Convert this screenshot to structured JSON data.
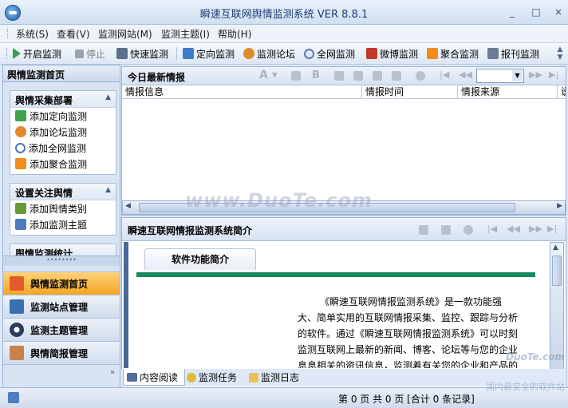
{
  "app": {
    "title": "瞬速互联网舆情监测系统 VER 8.8.1"
  },
  "window": {
    "minimize": "_",
    "restore": "□",
    "close": "×"
  },
  "menu": [
    "系统(S)",
    "查看(V)",
    "监测网站(M)",
    "监测主题(I)",
    "帮助(H)"
  ],
  "toolbar": [
    {
      "label": "开启监测",
      "icon": "play-icon",
      "color": "#3aa04a"
    },
    {
      "label": "停止",
      "icon": "stop-icon",
      "color": "#9aa3ad"
    },
    {
      "label": "快速监测",
      "icon": "printer-icon",
      "color": "#5b6f8a"
    },
    {
      "label": "定向监测",
      "icon": "target-icon",
      "color": "#3e7ec9"
    },
    {
      "label": "监测论坛",
      "icon": "users-icon",
      "color": "#e08a2e"
    },
    {
      "label": "全网监测",
      "icon": "search-icon",
      "color": "#5a7bb0"
    },
    {
      "label": "微博监测",
      "icon": "weibo-icon",
      "color": "#c0392b"
    },
    {
      "label": "聚合监测",
      "icon": "rss-icon",
      "color": "#f28c1c"
    },
    {
      "label": "报刊监测",
      "icon": "newspaper-icon",
      "color": "#6b7d95"
    }
  ],
  "left": {
    "header": "舆情监测首页",
    "groups": [
      {
        "title": "舆情采集部署",
        "items": [
          {
            "label": "添加定向监测",
            "icon": "add-target-icon",
            "color": "#3fa34d"
          },
          {
            "label": "添加论坛监测",
            "icon": "add-forum-icon",
            "color": "#e08a2e"
          },
          {
            "label": "添加全网监测",
            "icon": "add-search-icon",
            "color": "#4d78b8"
          },
          {
            "label": "添加聚合监测",
            "icon": "add-rss-icon",
            "color": "#f28c1c"
          }
        ]
      },
      {
        "title": "设置关注舆情",
        "items": [
          {
            "label": "添加舆情类别",
            "icon": "category-icon",
            "color": "#6a9a3a"
          },
          {
            "label": "添加监测主题",
            "icon": "topic-icon",
            "color": "#4f7bbf"
          }
        ]
      },
      {
        "title": "舆情监测统计",
        "items": []
      }
    ],
    "nav": [
      {
        "label": "舆情监测首页",
        "icon": "home-icon",
        "active": true
      },
      {
        "label": "监测站点管理",
        "icon": "site-icon",
        "active": false
      },
      {
        "label": "监测主题管理",
        "icon": "eye-icon",
        "active": false
      },
      {
        "label": "舆情简报管理",
        "icon": "brief-icon",
        "active": false
      }
    ]
  },
  "news": {
    "title": "今日最新情报",
    "columns": [
      "情报信息",
      "情报时间",
      "情报来源",
      "说"
    ]
  },
  "intro": {
    "title": "瞬速互联网情报监测系统简介",
    "tab": "软件功能简介",
    "lines": [
      "《瞬速互联网情报监测系统》是一款功能强",
      "大、简单实用的互联网情报采集、监控、跟踪与分析",
      "的软件。通过《瞬速互联网情报监测系统》可以时刻",
      "监测互联网上最新的新闻、博客、论坛等与您的企业",
      "息息相关的资讯信息，监测着有关您的企业和产品的"
    ]
  },
  "bottom_tabs": [
    "内容阅读",
    "监测任务",
    "监测日志"
  ],
  "status": {
    "text": "第 0 页 共 0 页 [合计 0 条记录]"
  },
  "watermarks": [
    "www.DuoTe.com",
    "DuoTe.com",
    "国内最安全的软件站"
  ]
}
